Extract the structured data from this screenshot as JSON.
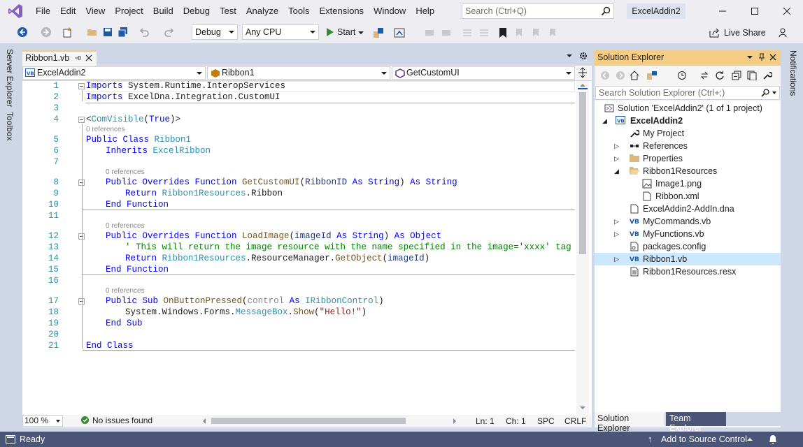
{
  "menu": [
    "File",
    "Edit",
    "View",
    "Project",
    "Build",
    "Debug",
    "Test",
    "Analyze",
    "Tools",
    "Extensions",
    "Window",
    "Help"
  ],
  "search": {
    "placeholder": "Search (Ctrl+Q)"
  },
  "solution_title": "ExcelAddin2",
  "toolbar": {
    "config": "Debug",
    "platform": "Any CPU",
    "start_label": "Start",
    "live_share": "Live Share"
  },
  "left_tabs": [
    "Server Explorer",
    "Toolbox"
  ],
  "right_tabs": [
    "Notifications"
  ],
  "editor": {
    "tab_label": "Ribbon1.vb",
    "nav": {
      "project": "ExcelAddin2",
      "type": "Ribbon1",
      "member": "GetCustomUI"
    },
    "refs_label": "0 references",
    "lines": [
      "1",
      "2",
      "3",
      "4",
      "5",
      "6",
      "7",
      "8",
      "9",
      "10",
      "11",
      "12",
      "13",
      "14",
      "15",
      "16",
      "17",
      "18",
      "19",
      "20",
      "21"
    ],
    "code": {
      "l1_kw": "Imports",
      "l1_rest": " System.Runtime.InteropServices",
      "l2_kw": "Imports",
      "l2_rest": " ExcelDna.Integration.CustomUI",
      "l4_a": "<",
      "l4_ty": "ComVisible",
      "l4_b": "(",
      "l4_kw": "True",
      "l4_c": ")>",
      "l5_kw": "Public Class ",
      "l5_ty": "Ribbon1",
      "l6_kw": "Inherits ",
      "l6_ty": "ExcelRibbon",
      "l8_kw": "Public Overrides Function ",
      "l8_fn": "GetCustomUI",
      "l8_a": "(",
      "l8_pa": "RibbonID",
      "l8_kw2": " As String",
      ")": "",
      "l8_b": ")",
      "l8_kw3": " As String",
      "l9_kw": "Return ",
      "l9_ty": "Ribbon1Resources",
      "l9_rest": ".Ribbon",
      "l10_kw": "End Function",
      "l12_kw": "Public Overrides Function ",
      "l12_fn": "LoadImage",
      "l12_a": "(",
      "l12_pa": "imageId",
      "l12_kw2": " As String",
      "l12_b": ")",
      "l12_kw3": " As Object",
      "l13_cm": "' This will return the image resource with the name specified in the image='xxxx' tag",
      "l14_kw": "Return ",
      "l14_ty": "Ribbon1Resources",
      "l14_rest": ".ResourceManager.",
      "l14_fn": "GetObject",
      "l14_a": "(",
      "l14_pa": "imageId",
      "l14_b": ")",
      "l15_kw": "End Function",
      "l17_kw": "Public Sub ",
      "l17_fn": "OnButtonPressed",
      "l17_a": "(",
      "l17_pa": "control",
      "l17_kw2": " As ",
      "l17_ty": "IRibbonControl",
      "l17_b": ")",
      "l18_a": "System.Windows.Forms.",
      "l18_ty": "MessageBox",
      "l18_b": ".",
      "l18_fn": "Show",
      "l18_c": "(",
      "l18_str": "\"Hello!\"",
      "l18_d": ")",
      "l19_kw": "End Sub",
      "l21_kw": "End Class"
    },
    "status": {
      "zoom": "100 %",
      "issues": "No issues found",
      "ln": "Ln: 1",
      "ch": "Ch: 1",
      "spc": "SPC",
      "crlf": "CRLF"
    }
  },
  "solution_explorer": {
    "title": "Solution Explorer",
    "search_placeholder": "Search Solution Explorer (Ctrl+;)",
    "items": [
      {
        "label": "Solution 'ExcelAddin2' (1 of 1 project)",
        "icon": "solution-icon"
      },
      {
        "label": "ExcelAddin2",
        "icon": "vb-project-icon"
      },
      {
        "label": "My Project",
        "icon": "wrench-icon"
      },
      {
        "label": "References",
        "icon": "references-icon"
      },
      {
        "label": "Properties",
        "icon": "folder-icon"
      },
      {
        "label": "Ribbon1Resources",
        "icon": "folder-open-icon"
      },
      {
        "label": "Image1.png",
        "icon": "image-file-icon"
      },
      {
        "label": "Ribbon.xml",
        "icon": "xml-file-icon"
      },
      {
        "label": "ExcelAddin2-AddIn.dna",
        "icon": "file-icon"
      },
      {
        "label": "MyCommands.vb",
        "icon": "vb-file-icon"
      },
      {
        "label": "MyFunctions.vb",
        "icon": "vb-file-icon"
      },
      {
        "label": "packages.config",
        "icon": "config-file-icon"
      },
      {
        "label": "Ribbon1.vb",
        "icon": "vb-file-icon"
      },
      {
        "label": "Ribbon1Resources.resx",
        "icon": "resx-file-icon"
      }
    ],
    "tabs": [
      "Solution Explorer",
      "Team Explorer"
    ]
  },
  "statusbar": {
    "ready": "Ready",
    "source_control": "Add to Source Control"
  },
  "colors": {
    "accent": "#f5cc84",
    "statusbar": "#4a5577",
    "keyword": "#0000ff",
    "type": "#2b91af",
    "comment": "#008000",
    "string": "#a31515"
  }
}
